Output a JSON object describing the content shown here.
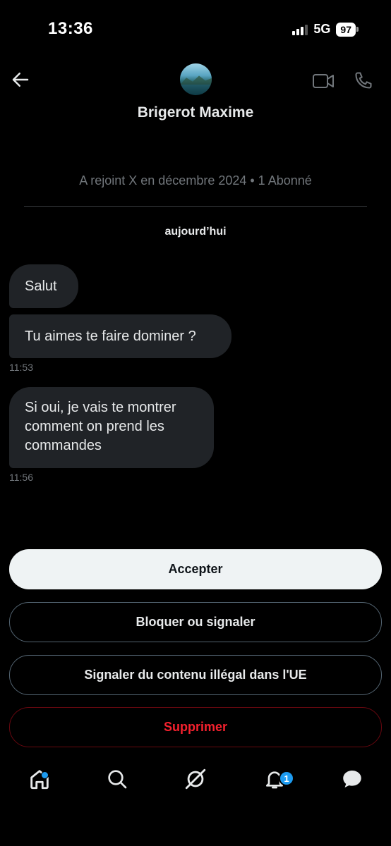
{
  "status": {
    "time": "13:36",
    "network": "5G",
    "battery": "97"
  },
  "header": {
    "contact_name": "Brigerot Maxime"
  },
  "info": {
    "joined": "A rejoint X en décembre 2024 • 1 Abonné",
    "day": "aujourd’hui"
  },
  "messages": [
    {
      "text": "Salut"
    },
    {
      "text": "Tu aimes te faire dominer ?",
      "time": "11:53"
    },
    {
      "lines": [
        "Si oui, je vais te montrer",
        "comment on prend les",
        "commandes"
      ],
      "time": "11:56"
    }
  ],
  "actions": {
    "accept": "Accepter",
    "block": "Bloquer ou signaler",
    "report_eu": "Signaler du contenu illégal dans l'UE",
    "delete": "Supprimer"
  },
  "tabbar": {
    "notification_count": "1"
  },
  "icons": [
    "back-arrow-icon",
    "video-call-icon",
    "phone-icon",
    "home-icon",
    "search-icon",
    "grok-icon",
    "notifications-bell-icon",
    "messages-icon"
  ],
  "colors": {
    "accent": "#1d9bf0",
    "danger": "#f4212e",
    "bubble": "#202327"
  }
}
